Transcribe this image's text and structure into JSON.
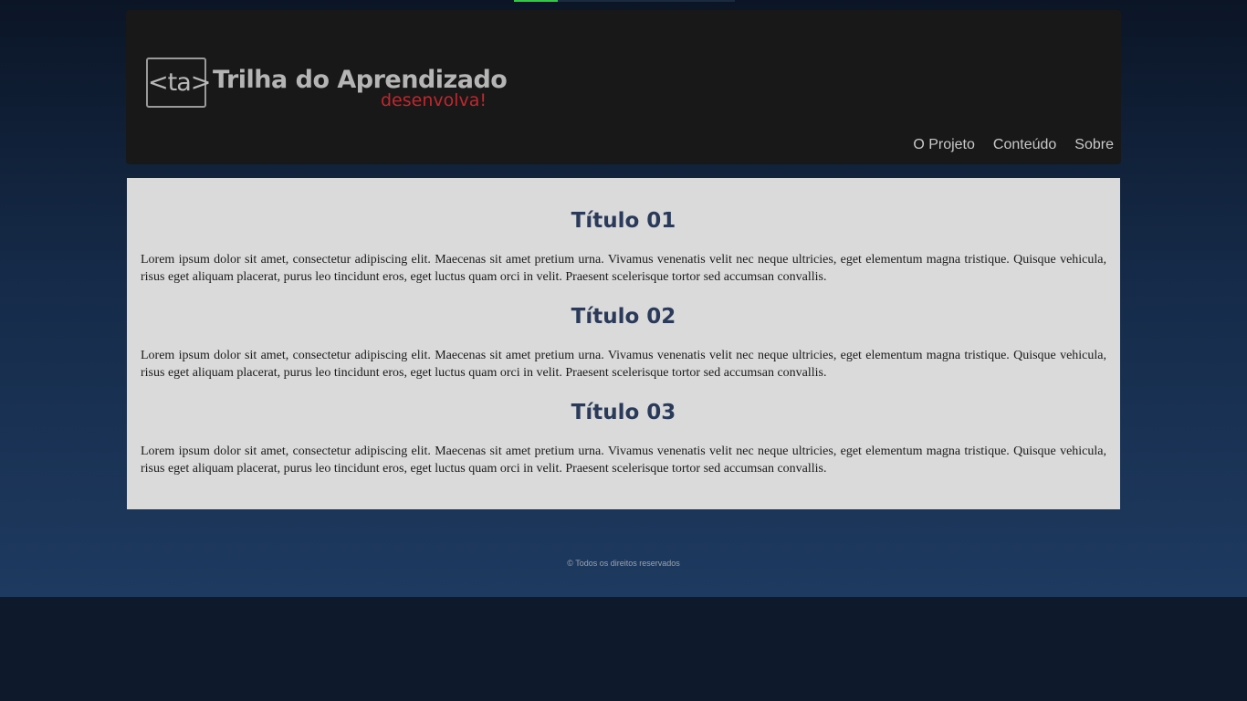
{
  "header": {
    "logo_mark": "<ta>",
    "logo_name": "Trilha do Aprendizado",
    "logo_tagline": "desenvolva!",
    "nav": [
      {
        "label": "O Projeto"
      },
      {
        "label": "Conteúdo"
      },
      {
        "label": "Sobre"
      }
    ]
  },
  "sections": [
    {
      "title": "Título 01",
      "text": "Lorem ipsum dolor sit amet, consectetur adipiscing elit. Maecenas sit amet pretium urna. Vivamus venenatis velit nec neque ultricies, eget elementum magna tristique. Quisque vehicula, risus eget aliquam placerat, purus leo tincidunt eros, eget luctus quam orci in velit. Praesent scelerisque tortor sed accumsan convallis."
    },
    {
      "title": "Título 02",
      "text": "Lorem ipsum dolor sit amet, consectetur adipiscing elit. Maecenas sit amet pretium urna. Vivamus venenatis velit nec neque ultricies, eget elementum magna tristique. Quisque vehicula, risus eget aliquam placerat, purus leo tincidunt eros, eget luctus quam orci in velit. Praesent scelerisque tortor sed accumsan convallis."
    },
    {
      "title": "Título 03",
      "text": "Lorem ipsum dolor sit amet, consectetur adipiscing elit. Maecenas sit amet pretium urna. Vivamus venenatis velit nec neque ultricies, eget elementum magna tristique. Quisque vehicula, risus eget aliquam placerat, purus leo tincidunt eros, eget luctus quam orci in velit. Praesent scelerisque tortor sed accumsan convallis."
    }
  ],
  "footer": {
    "copyright": "© Todos os direitos reservados"
  },
  "colors": {
    "header_bg": "#181818",
    "content_bg": "#dadada",
    "title_color": "#2a3a5a",
    "tagline_color": "#c0272d",
    "loader_accent": "#2ecc40"
  }
}
